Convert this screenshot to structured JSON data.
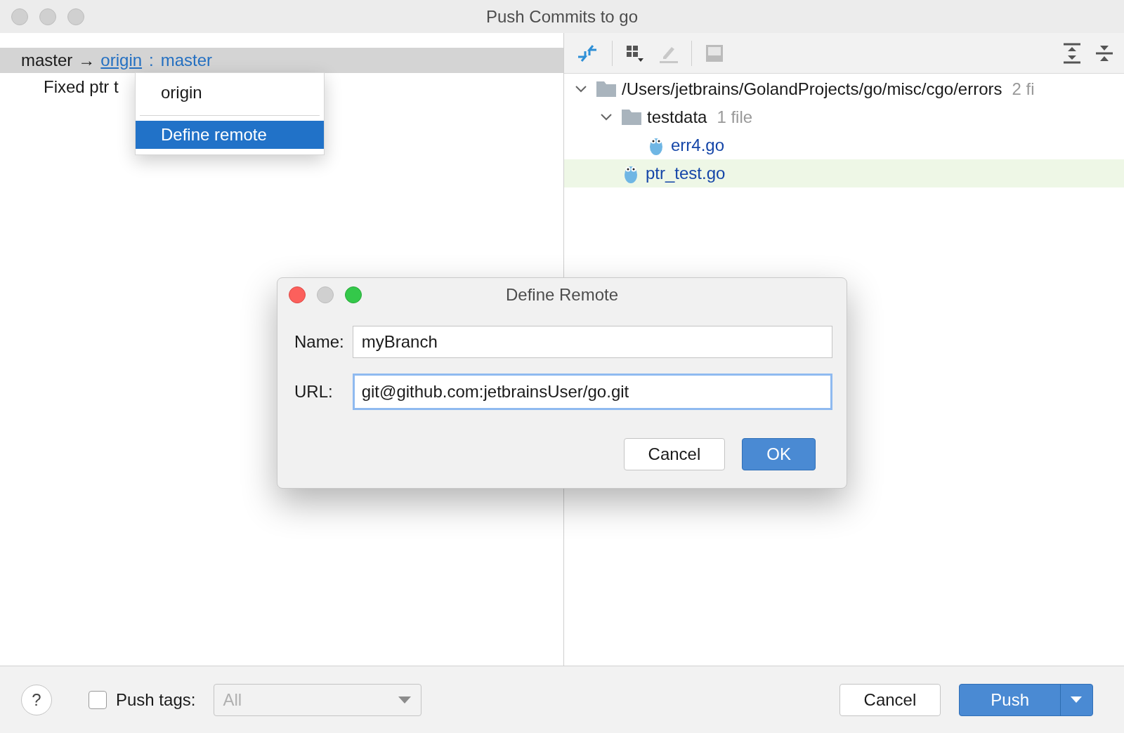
{
  "window": {
    "title": "Push Commits to go"
  },
  "commits": {
    "branch_row": {
      "local": "master",
      "arrow": "→",
      "remote": "origin",
      "separator": ":",
      "remote_branch": "master",
      "selected": true
    },
    "commit_message": "Fixed ptr t"
  },
  "remote_menu": {
    "items": [
      {
        "label": "origin",
        "selected": false
      },
      {
        "label": "Define remote",
        "selected": true
      }
    ]
  },
  "changes_tree": [
    {
      "kind": "folder",
      "name": "/Users/jetbrains/GolandProjects/go/misc/cgo/errors",
      "count": "2 fi",
      "expanded": true,
      "selected": false,
      "children": [
        {
          "kind": "folder",
          "name": "testdata",
          "count": "1 file",
          "expanded": true,
          "selected": false,
          "children": [
            {
              "kind": "file",
              "name": "err4.go",
              "selected": false
            }
          ]
        },
        {
          "kind": "file",
          "name": "ptr_test.go",
          "selected": true
        }
      ]
    }
  ],
  "define_remote_dialog": {
    "title": "Define Remote",
    "fields": [
      {
        "label": "Name:",
        "value": "myBranch",
        "focused": false
      },
      {
        "label": "URL:",
        "value": "git@github.com:jetbrainsUser/go.git",
        "focused": true
      }
    ],
    "buttons": [
      {
        "label": "Cancel",
        "default": false
      },
      {
        "label": "OK",
        "default": true
      }
    ]
  },
  "footer": {
    "help": "?",
    "push_tags": {
      "label": "Push tags:",
      "checked": false
    },
    "tags_dropdown": {
      "value": "All",
      "disabled": true
    },
    "buttons": [
      {
        "label": "Cancel",
        "default": false,
        "split": false
      },
      {
        "label": "Push",
        "default": true,
        "split": true
      }
    ]
  }
}
